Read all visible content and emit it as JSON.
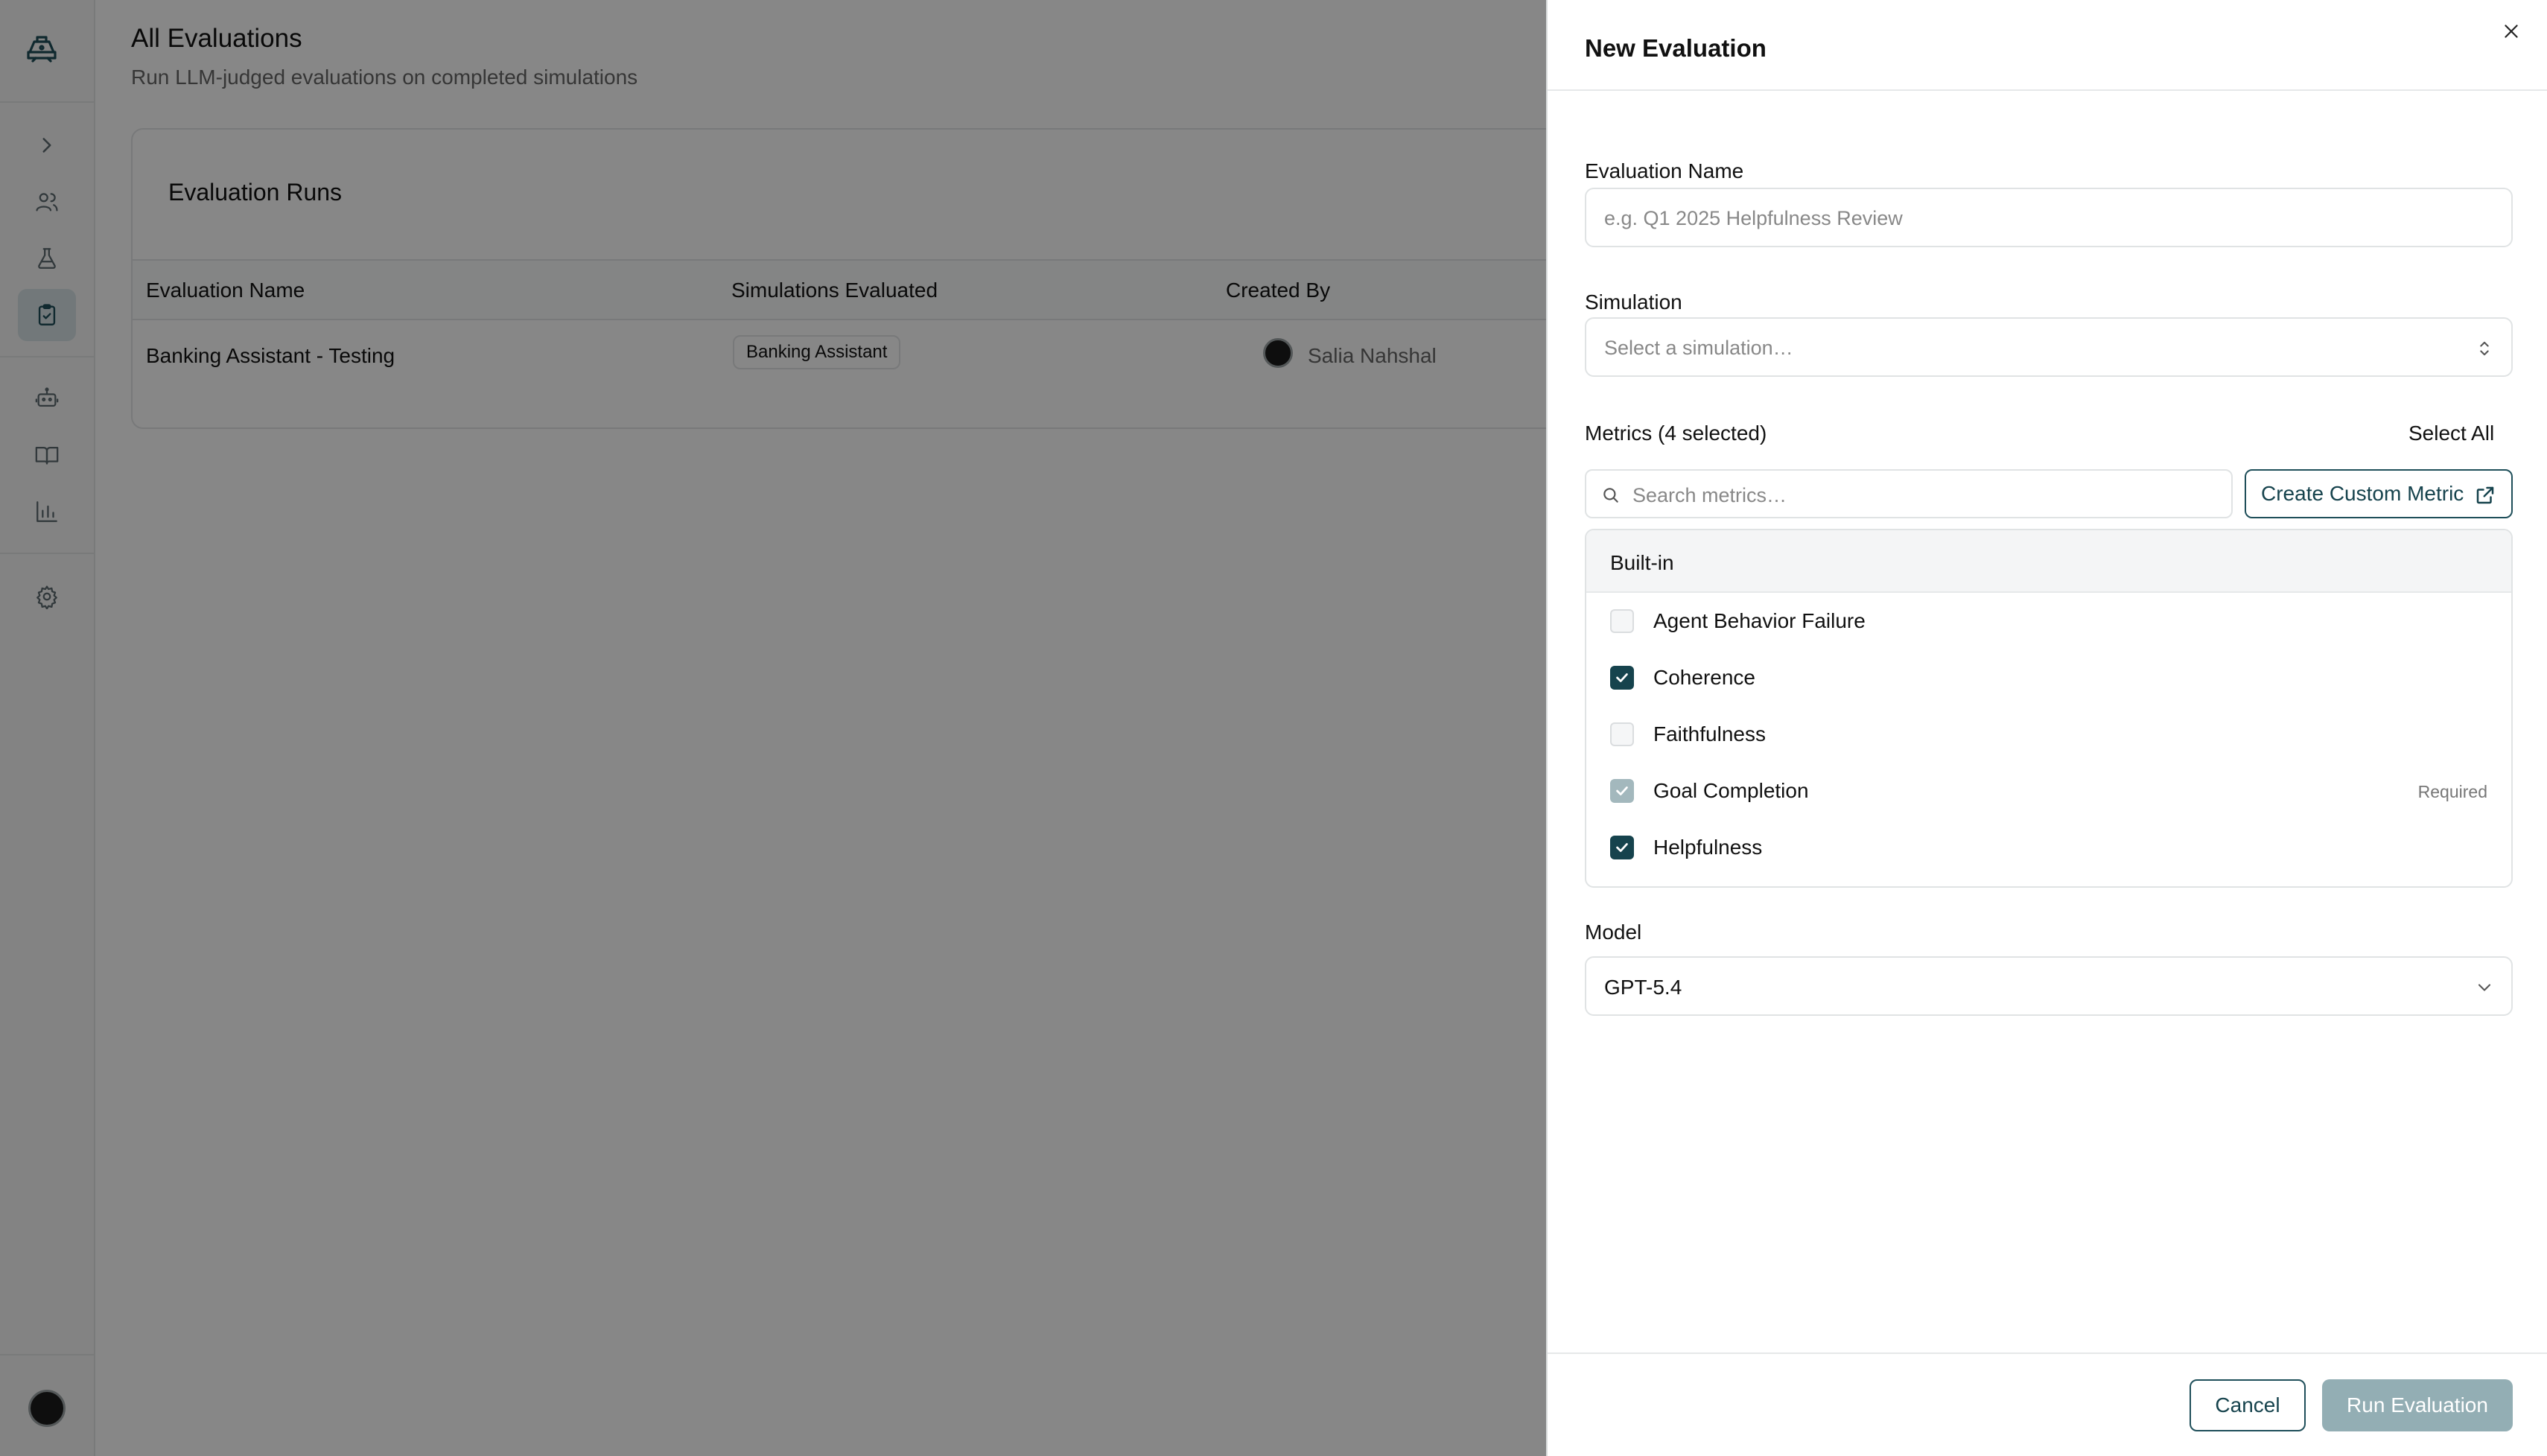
{
  "sidebar": {
    "items": [
      {
        "icon": "chevron-right-icon"
      },
      {
        "icon": "users-icon"
      },
      {
        "icon": "flask-icon"
      },
      {
        "icon": "clipboard-check-icon",
        "active": true
      },
      {
        "icon": "bot-icon"
      },
      {
        "icon": "book-open-icon"
      },
      {
        "icon": "bar-chart-icon"
      },
      {
        "icon": "gear-icon"
      }
    ]
  },
  "page": {
    "title": "All Evaluations",
    "subtitle": "Run LLM-judged evaluations on completed simulations"
  },
  "runs": {
    "title": "Evaluation Runs",
    "columns": [
      "Evaluation Name",
      "Simulations Evaluated",
      "Created By"
    ],
    "rows": [
      {
        "name": "Banking Assistant - Testing",
        "simulation": "Banking Assistant",
        "created_by": "Salia Nahshal"
      }
    ]
  },
  "drawer": {
    "title": "New Evaluation",
    "name_label": "Evaluation Name",
    "name_placeholder": "e.g. Q1 2025 Helpfulness Review",
    "simulation_label": "Simulation",
    "simulation_placeholder": "Select a simulation…",
    "metrics_label": "Metrics (4 selected)",
    "select_all": "Select All",
    "search_placeholder": "Search metrics…",
    "create_custom": "Create Custom Metric",
    "group": "Built-in",
    "metrics": [
      {
        "name": "Agent Behavior Failure",
        "checked": false
      },
      {
        "name": "Coherence",
        "checked": true
      },
      {
        "name": "Faithfulness",
        "checked": false
      },
      {
        "name": "Goal Completion",
        "checked": true,
        "required": "Required"
      },
      {
        "name": "Helpfulness",
        "checked": true
      }
    ],
    "model_label": "Model",
    "model_value": "GPT-5.4",
    "cancel": "Cancel",
    "run": "Run Evaluation"
  },
  "colors": {
    "accent": "#16434d",
    "run_disabled": "#93aeb4",
    "overlay": "rgba(0,0,0,0.47)"
  }
}
